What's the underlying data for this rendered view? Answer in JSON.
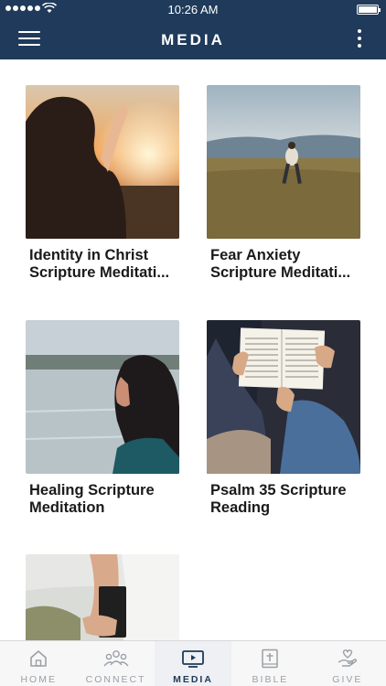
{
  "status": {
    "time": "10:26 AM"
  },
  "header": {
    "title": "MEDIA"
  },
  "items": [
    {
      "line1": "Identity in Christ",
      "line2": "Scripture Meditati..."
    },
    {
      "line1": "Fear Anxiety",
      "line2": "Scripture Meditati..."
    },
    {
      "line1": "Healing Scripture",
      "line2": "Meditation"
    },
    {
      "line1": "Psalm 35 Scripture",
      "line2": "Reading"
    },
    {
      "line1": "",
      "line2": ""
    }
  ],
  "tabs": [
    {
      "label": "HOME",
      "icon": "home-icon"
    },
    {
      "label": "CONNECT",
      "icon": "people-icon"
    },
    {
      "label": "MEDIA",
      "icon": "tv-icon",
      "active": true
    },
    {
      "label": "BIBLE",
      "icon": "bible-icon"
    },
    {
      "label": "GIVE",
      "icon": "hand-heart-icon"
    }
  ],
  "colors": {
    "header": "#1f3a5a",
    "active_tab": "#1f3a5a",
    "inactive_tab": "#9aa0a6"
  }
}
